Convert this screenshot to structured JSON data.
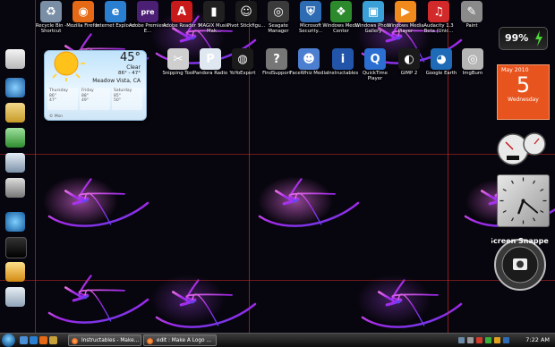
{
  "desktop": {
    "icons": [
      {
        "label": "Recycle Bin - Shortcut",
        "icon": "recycle-bin-icon",
        "color": "#7a8fa6",
        "glyph": "♻"
      },
      {
        "label": "Mozilla Firefox",
        "icon": "firefox-icon",
        "color": "#e66a16",
        "glyph": "◉"
      },
      {
        "label": "Internet Explorer",
        "icon": "internet-explorer-icon",
        "color": "#2a7fd1",
        "glyph": "e"
      },
      {
        "label": "Adobe Premiere E...",
        "icon": "premiere-icon",
        "color": "#4b1f74",
        "glyph": "pre"
      },
      {
        "label": "Adobe Reader 9",
        "icon": "adobe-reader-icon",
        "color": "#c81a1a",
        "glyph": "A"
      },
      {
        "label": "MAGIX Music Mak...",
        "icon": "magix-icon",
        "color": "#202020",
        "glyph": "▮"
      },
      {
        "label": "Pivot Stickfigu...",
        "icon": "pivot-icon",
        "color": "#1a1a1a",
        "glyph": "☺"
      },
      {
        "label": "Seagate Manager",
        "icon": "seagate-icon",
        "color": "#3b3b3b",
        "glyph": "◎"
      },
      {
        "label": "Microsoft Security...",
        "icon": "security-icon",
        "color": "#2d6bb3",
        "glyph": "⛨"
      },
      {
        "label": "Windows Media Center",
        "icon": "media-center-icon",
        "color": "#2c8a2c",
        "glyph": "❖"
      },
      {
        "label": "Windows Photo Gallery",
        "icon": "photo-gallery-icon",
        "color": "#3aa0d8",
        "glyph": "▣"
      },
      {
        "label": "Windows Media Player",
        "icon": "media-player-icon",
        "color": "#f08a1c",
        "glyph": "▶"
      },
      {
        "label": "Audacity 1.3 Beta (Unic...",
        "icon": "audacity-icon",
        "color": "#d22a2a",
        "glyph": "♫"
      },
      {
        "label": "Paint",
        "icon": "paint-icon",
        "color": "#8a8a8a",
        "glyph": "✎"
      },
      {
        "label": "Snipping Tool",
        "icon": "snipping-tool-icon",
        "color": "#cfcfcf",
        "glyph": "✂"
      },
      {
        "label": "Pandora Radio",
        "icon": "pandora-icon",
        "color": "#dfe8f0",
        "glyph": "P"
      },
      {
        "label": "YoYoExpert",
        "icon": "yoyo-icon",
        "color": "#1a1a1a",
        "glyph": "◍"
      },
      {
        "label": "FindSupport",
        "icon": "find-support-icon",
        "color": "#777",
        "glyph": "?"
      },
      {
        "label": "FaceWhiz Media",
        "icon": "facewhiz-icon",
        "color": "#4d7fd1",
        "glyph": "☻"
      },
      {
        "label": "Instructables",
        "icon": "instructables-icon",
        "color": "#2255aa",
        "glyph": "i"
      },
      {
        "label": "QuickTime Player",
        "icon": "quicktime-icon",
        "color": "#2a6fd1",
        "glyph": "Q"
      },
      {
        "label": "GIMP 2",
        "icon": "gimp-icon",
        "color": "#1a1a1a",
        "glyph": "◐"
      },
      {
        "label": "Google Earth",
        "icon": "google-earth-icon",
        "color": "#1f6bb8",
        "glyph": "◕"
      },
      {
        "label": "ImgBurn",
        "icon": "imgburn-icon",
        "color": "#b5b5b5",
        "glyph": "◎"
      }
    ]
  },
  "gadgets": {
    "weather": {
      "temperature": "45°",
      "condition": "Clear",
      "range": "86° - 47°",
      "location": "Meadow Vista, CA",
      "forecast": [
        {
          "day": "Thursday",
          "hi": "86°",
          "lo": "47°"
        },
        {
          "day": "Friday",
          "hi": "88°",
          "lo": "49°"
        },
        {
          "day": "Saturday",
          "hi": "85°",
          "lo": "50°"
        }
      ],
      "source": "© Msn"
    },
    "battery": {
      "percent": "99%"
    },
    "calendar": {
      "month": "May 2010",
      "day": "5",
      "weekday": "Wednesday"
    },
    "clock": {
      "hour_hand_angle": 200,
      "minute_hand_angle": 130
    },
    "screen_snapper": {
      "title": "Screen Snapper"
    }
  },
  "taskbar": {
    "tasks": [
      {
        "label": "Instructables - Make..."
      },
      {
        "label": "edit : Make A Logo ..."
      }
    ],
    "time": "7:22 AM",
    "colors": {
      "start": "#1d5f9c",
      "accent": "#e0441a"
    }
  }
}
